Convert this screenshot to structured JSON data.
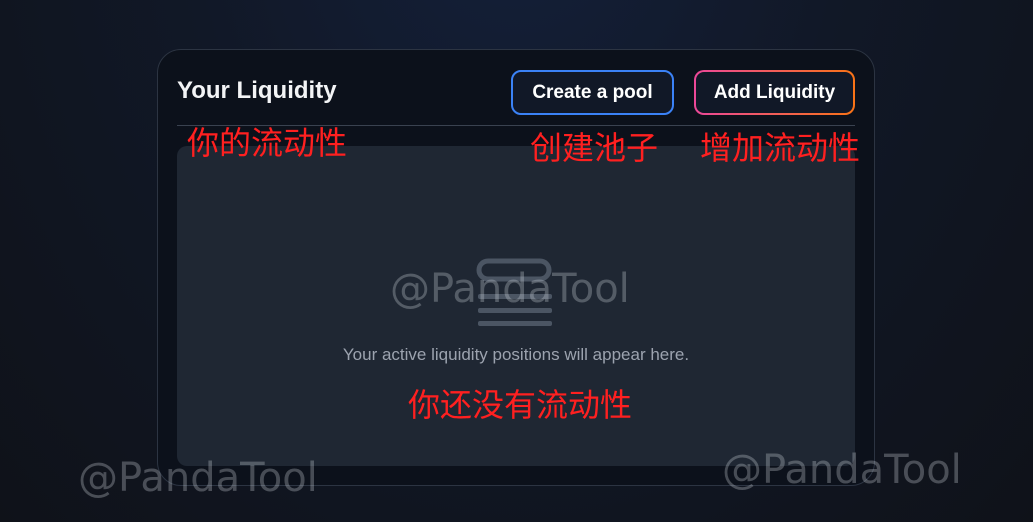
{
  "header": {
    "title": "Your Liquidity",
    "create_pool_label": "Create a pool",
    "add_liquidity_label": "Add Liquidity"
  },
  "empty_state": {
    "icon": "inbox-stack-icon",
    "message": "Your active liquidity positions will appear here."
  },
  "annotations": {
    "your_liquidity_cn": "你的流动性",
    "create_pool_cn": "创建池子",
    "add_liquidity_cn": "增加流动性",
    "no_liquidity_cn": "你还没有流动性"
  },
  "watermarks": {
    "center": "@PandaTool",
    "bottom_left": "@PandaTool",
    "bottom_right": "@PandaTool"
  },
  "colors": {
    "create_pool_border": "#3b82f6",
    "add_liquidity_border_start": "#ec4899",
    "add_liquidity_border_end": "#f97316",
    "annotation": "#ff2020"
  }
}
